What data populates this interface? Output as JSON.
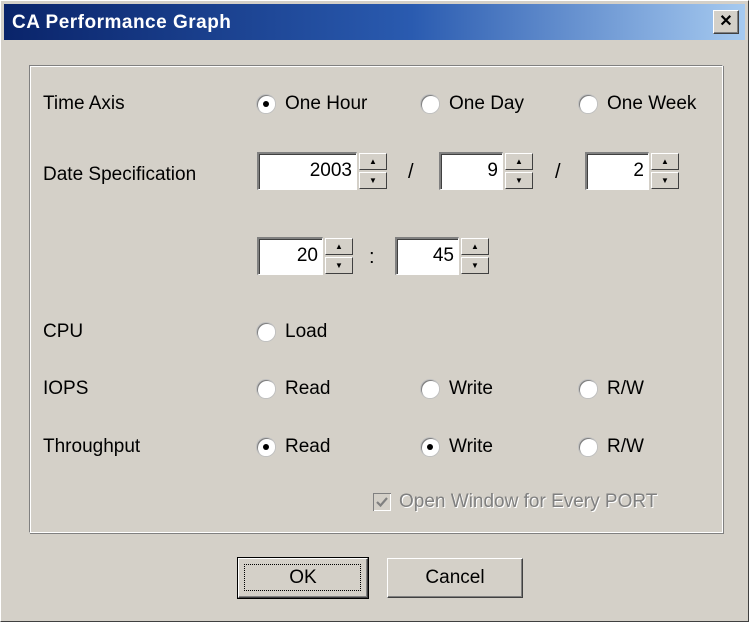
{
  "window": {
    "title": "CA Performance Graph",
    "close_glyph": "✕"
  },
  "time_axis": {
    "label": "Time Axis",
    "options": [
      {
        "label": "One Hour",
        "selected": true
      },
      {
        "label": "One Day",
        "selected": false
      },
      {
        "label": "One Week",
        "selected": false
      }
    ]
  },
  "date_spec": {
    "label": "Date Specification",
    "year": "2003",
    "month": "9",
    "day": "2",
    "hour": "20",
    "minute": "45",
    "date_separator": "/",
    "time_separator": ":"
  },
  "cpu": {
    "label": "CPU",
    "options": [
      {
        "label": "Load",
        "selected": false
      }
    ]
  },
  "iops": {
    "label": "IOPS",
    "options": [
      {
        "label": "Read",
        "selected": false
      },
      {
        "label": "Write",
        "selected": false
      },
      {
        "label": "R/W",
        "selected": false
      }
    ]
  },
  "throughput": {
    "label": "Throughput",
    "options": [
      {
        "label": "Read",
        "selected": true
      },
      {
        "label": "Write",
        "selected": true
      },
      {
        "label": "R/W",
        "selected": false
      }
    ]
  },
  "open_window": {
    "label": "Open Window for Every PORT",
    "checked": true,
    "enabled": false
  },
  "buttons": {
    "ok": "OK",
    "cancel": "Cancel"
  },
  "colors": {
    "title_start": "#0a246a",
    "title_end": "#a6caf0",
    "face": "#d4d0c8",
    "disabled_text": "#808080"
  },
  "icons": {
    "spin_up": "up-arrow-icon",
    "spin_down": "down-arrow-icon",
    "check": "checkmark-icon"
  }
}
